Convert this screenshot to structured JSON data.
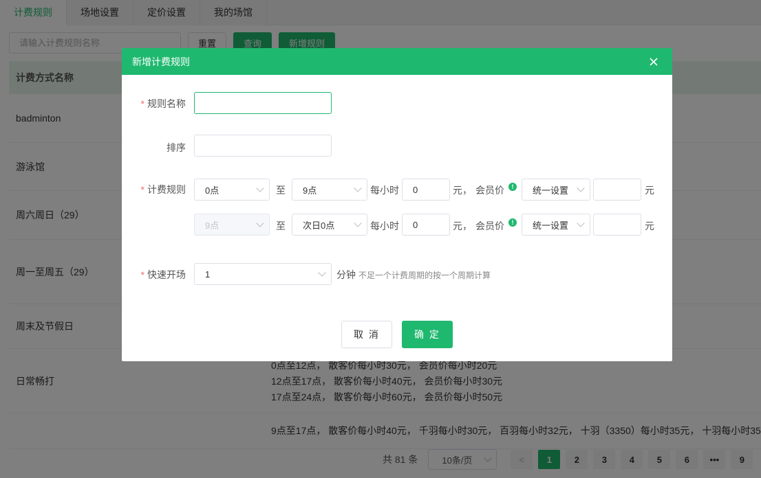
{
  "tabs": [
    "计费规则",
    "场地设置",
    "定价设置",
    "我的场馆"
  ],
  "toolbar": {
    "search_placeholder": "请输入计费规则名称",
    "reset_label": "重置",
    "query_label": "查询",
    "add_label": "新增规则"
  },
  "table": {
    "header": "计费方式名称",
    "rows": [
      {
        "name": "badminton",
        "lines": []
      },
      {
        "name": "游泳馆",
        "lines": []
      },
      {
        "name": "周六周日（29）",
        "lines": []
      },
      {
        "name": "周一至周五（29）",
        "lines": []
      },
      {
        "name": "周末及节假日",
        "lines": []
      },
      {
        "name": "日常畅打",
        "lines": [
          "0点至12点， 散客价每小时30元， 会员价每小时20元",
          "12点至17点， 散客价每小时40元， 会员价每小时30元",
          "17点至24点， 散客价每小时60元， 会员价每小时50元"
        ]
      },
      {
        "name": "",
        "lines": [
          "9点至17点， 散客价每小时40元， 千羽每小时30元， 百羽每小时32元， 十羽（3350）每小时35元， 十羽每小时35"
        ]
      }
    ]
  },
  "pagination": {
    "total": "共 81 条",
    "page_size": "10条/页",
    "prev": "<",
    "pages": [
      "1",
      "2",
      "3",
      "4",
      "5",
      "6",
      "•••",
      "9"
    ],
    "current": "1"
  },
  "dialog": {
    "title": "新增计费规则",
    "rule_name_label": "规则名称",
    "rule_name_value": "",
    "sort_label": "排序",
    "sort_value": "",
    "billing_label": "计费规则",
    "rows": [
      {
        "from": "0点",
        "from_disabled": false,
        "to_label": "至",
        "to": "9点",
        "per_hour": "每小时",
        "price": "0",
        "yuan_comma": "元，",
        "member_label": "会员价",
        "mode": "统一设置",
        "member_price": "",
        "yuan": "元"
      },
      {
        "from": "9点",
        "from_disabled": true,
        "to_label": "至",
        "to": "次日0点",
        "per_hour": "每小时",
        "price": "0",
        "yuan_comma": "元，",
        "member_label": "会员价",
        "mode": "统一设置",
        "member_price": "",
        "yuan": "元"
      }
    ],
    "quick_label": "快速开场",
    "quick_value": "1",
    "minute_label": "分钟",
    "quick_hint": "不足一个计费周期的按一个周期计算",
    "cancel_label": "取 消",
    "confirm_label": "确 定"
  },
  "colors": {
    "accent": "#1fb86f",
    "required": "#f56c6c"
  }
}
